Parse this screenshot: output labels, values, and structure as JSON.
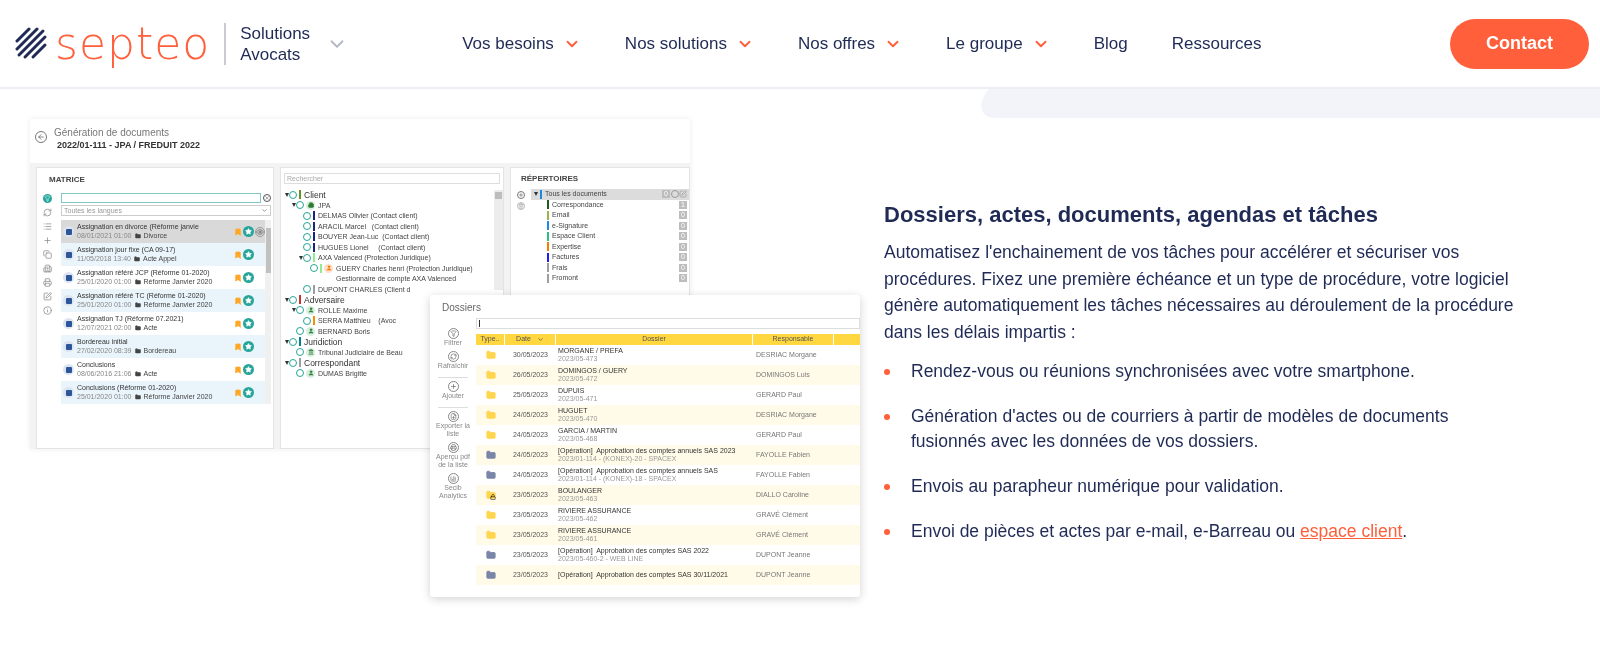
{
  "header": {
    "logo": "septeo",
    "product": "Solutions Avocats",
    "nav": [
      {
        "label": "Vos besoins",
        "dropdown": true
      },
      {
        "label": "Nos solutions",
        "dropdown": true
      },
      {
        "label": "Nos offres",
        "dropdown": true
      },
      {
        "label": "Le groupe",
        "dropdown": true
      },
      {
        "label": "Blog",
        "dropdown": false
      },
      {
        "label": "Ressources",
        "dropdown": false
      }
    ],
    "contact": "Contact"
  },
  "app_window": {
    "title": "Génération de documents",
    "subtitle": "2022/01-111 - JPA / FREDUIT 2022",
    "matrice": {
      "heading": "MATRICE",
      "language_select": "Toutes les langues",
      "items": [
        {
          "title": "Assignation en divorce (Réforme janvie",
          "date": "08/01/2021 01:00",
          "category": "Divorce",
          "selected": true
        },
        {
          "title": "Assignation jour fixe (CA 09-17)",
          "date": "11/05/2018 13:40",
          "category": "Acte Appel",
          "selected": false
        },
        {
          "title": "Assignation référé JCP (Réforme 01-2020)",
          "date": "25/01/2020 01:00",
          "category": "Réforme Janvier 2020",
          "selected": false
        },
        {
          "title": "Assignation référé TC (Réforme 01-2020)",
          "date": "25/01/2020 01:00",
          "category": "Réforme Janvier 2020",
          "selected": false
        },
        {
          "title": "Assignation TJ (Réforme 07.2021)",
          "date": "12/07/2021 02:00",
          "category": "Acte",
          "selected": false
        },
        {
          "title": "Bordereau initial",
          "date": "27/02/2020 08:39",
          "category": "Bordereau",
          "selected": false
        },
        {
          "title": "Conclusions",
          "date": "08/06/2016 21:06",
          "category": "Acte",
          "selected": false
        },
        {
          "title": "Conclusions (Réforme 01-2020)",
          "date": "25/01/2020 01:00",
          "category": "Réforme Janvier 2020",
          "selected": false
        }
      ]
    },
    "contacts": {
      "search_placeholder": "Rechercher",
      "tree": [
        {
          "label": "Client",
          "kind": "group",
          "color": "#6b8e23",
          "expanded": true,
          "children": [
            {
              "label": "JPA",
              "kind": "company",
              "expanded": true,
              "children": [
                {
                  "label": "DELMAS Olivier (Contact client)",
                  "color": "#1a237e"
                },
                {
                  "label": "ARACIL Marcel   (Contact client)",
                  "color": "#1a237e"
                },
                {
                  "label": "BOUYER Jean-Luc  (Contact client)",
                  "color": "#1a237e"
                },
                {
                  "label": "HUGUES Lionel     (Contact client)",
                  "color": "#1a237e"
                },
                {
                  "label": "AXA Valenced (Protection Juridique)",
                  "color": "#90ee90",
                  "expanded": true,
                  "children": [
                    {
                      "label": "GUERY Charles henri (Protection Juridique)",
                      "note": "Gestionnaire de compte AXA Valenced",
                      "kind": "external",
                      "color": "#90ee90"
                    }
                  ]
                },
                {
                  "label": "DUPONT CHARLES (Client d",
                  "color": "#9e9e9e"
                }
              ]
            }
          ]
        },
        {
          "label": "Adversaire",
          "kind": "group",
          "color": "#d32f2f",
          "expanded": true,
          "children": [
            {
              "label": "ROLLE Maxime",
              "kind": "person",
              "expanded": true,
              "children": [
                {
                  "label": "SERRA Matthieu    (Avoc",
                  "color": "#ff8c00"
                }
              ]
            },
            {
              "label": "BERNARD Boris",
              "kind": "person"
            }
          ]
        },
        {
          "label": "Juridiction",
          "kind": "group",
          "color": "#00838f",
          "expanded": true,
          "children": [
            {
              "label": "Tribunal Judiciaire de Beau",
              "kind": "court"
            }
          ]
        },
        {
          "label": "Correspondant",
          "kind": "group",
          "color": "#9e9e9e",
          "expanded": true,
          "children": [
            {
              "label": "DUMAS Brigitte",
              "kind": "person"
            }
          ]
        }
      ]
    },
    "repertoires": {
      "heading": "RÉPERTOIRES",
      "root": {
        "label": "Tous les documents",
        "color": "#1e88e5",
        "count": "0",
        "selected": true,
        "expanded": true
      },
      "folders": [
        {
          "label": "Correspondance",
          "color": "#1b5e20",
          "count": "1",
          "selected": false
        },
        {
          "label": "Email",
          "color": "#9ab34a",
          "count": "0",
          "selected": false
        },
        {
          "label": "e-Signature",
          "color": "#1e88e5",
          "count": "0",
          "selected": false
        },
        {
          "label": "Espace Client",
          "color": "#26c281",
          "count": "0",
          "selected": false
        },
        {
          "label": "Expertise",
          "color": "#f57c00",
          "count": "0",
          "selected": false
        },
        {
          "label": "Factures",
          "color": "#1a1aff",
          "count": "0",
          "selected": false
        },
        {
          "label": "Frais",
          "color": "#9e9e9e",
          "count": "0",
          "selected": false
        },
        {
          "label": "Fromont",
          "color": "#9e9e9e",
          "count": "0",
          "selected": false
        }
      ]
    }
  },
  "dossiers_window": {
    "title": "Dossiers",
    "actions": [
      {
        "label": "Filtrer",
        "kind": "filter"
      },
      {
        "label": "Rafraîchir",
        "kind": "refresh"
      },
      {
        "label": "Ajouter",
        "kind": "add"
      },
      {
        "label": "Exporter la liste",
        "kind": "export"
      },
      {
        "label": "Aperçu pdf de la liste",
        "kind": "print"
      },
      {
        "label": "Secib Analytics",
        "kind": "analytics"
      }
    ],
    "columns": [
      "Type..",
      "Date",
      "Dossier",
      "Responsable"
    ],
    "rows": [
      {
        "kind": "folder",
        "date": "30/05/2023",
        "title": "MORGANE / PREFA",
        "number": "2023/05-473",
        "responsable": "DESRIAC Morgane"
      },
      {
        "kind": "folder",
        "date": "26/05/2023",
        "title": "DOMINGOS / GUERY",
        "number": "2023/05-472",
        "responsable": "DOMINGOS Luis"
      },
      {
        "kind": "folder",
        "date": "25/05/2023",
        "title": "DUPUIS",
        "number": "2023/05-471",
        "responsable": "GERARD Paul"
      },
      {
        "kind": "folder",
        "date": "24/05/2023",
        "title": "HUGUET",
        "number": "2023/05-470",
        "responsable": "DESRIAC Morgane"
      },
      {
        "kind": "folder",
        "date": "24/05/2023",
        "title": "GARCIA / MARTIN",
        "number": "2023/05-468",
        "responsable": "GERARD Paul"
      },
      {
        "kind": "operation",
        "date": "24/05/2023",
        "title": "[Opération]  Approbation des comptes annuels SAS 2023",
        "number": "2023/01-114 - (KONEX)-20 - SPACEX",
        "responsable": "FAYOLLE Fabien"
      },
      {
        "kind": "operation",
        "date": "24/05/2023",
        "title": "[Opération]  Approbation des comptes annuels SAS",
        "number": "2023/01-114 - (KONEX)-18 - SPACEX",
        "responsable": "FAYOLLE Fabien"
      },
      {
        "kind": "locked",
        "date": "23/05/2023",
        "title": "BOULANGER",
        "number": "2023/05-463",
        "responsable": "DIALLO Caroline"
      },
      {
        "kind": "folder",
        "date": "23/05/2023",
        "title": "RIVIERE ASSURANCE",
        "number": "2023/05-462",
        "responsable": "GRAVÉ Clément"
      },
      {
        "kind": "folder",
        "date": "23/05/2023",
        "title": "RIVIERE ASSURANCE",
        "number": "2023/05-461",
        "responsable": "GRAVÉ Clément"
      },
      {
        "kind": "operation",
        "date": "23/05/2023",
        "title": "[Opération]  Approbation des comptes SAS 2022",
        "number": "2023/05-460-2 - WEB LINE",
        "responsable": "DUPONT Jeanne"
      },
      {
        "kind": "operation",
        "date": "23/05/2023",
        "title": "[Opération]  Approbation des comptes SAS 30/11/2021",
        "responsable": "DUPONT Jeanne"
      }
    ]
  },
  "feature": {
    "heading": "Dossiers, actes, documents, agendas et tâches",
    "intro": "Automatisez l'enchainement de vos tâches pour accélérer et sécuriser vos procédures. Fixez une première échéance et un type de procédure, votre logiciel génère automatiquement les tâches nécessaires au déroulement de la procédure dans les délais impartis :",
    "bullets": [
      {
        "text": "Rendez-vous ou réunions synchronisées avec votre smartphone."
      },
      {
        "text": "Génération d'actes ou de courriers à partir de modèles de documents fusionnés avec les données de vos dossiers."
      },
      {
        "text": "Envois au parapheur numérique pour validation."
      },
      {
        "text": "Envoi de pièces et actes par e-mail, e-Barreau ou ",
        "link": "espace client",
        "after": "."
      }
    ]
  }
}
